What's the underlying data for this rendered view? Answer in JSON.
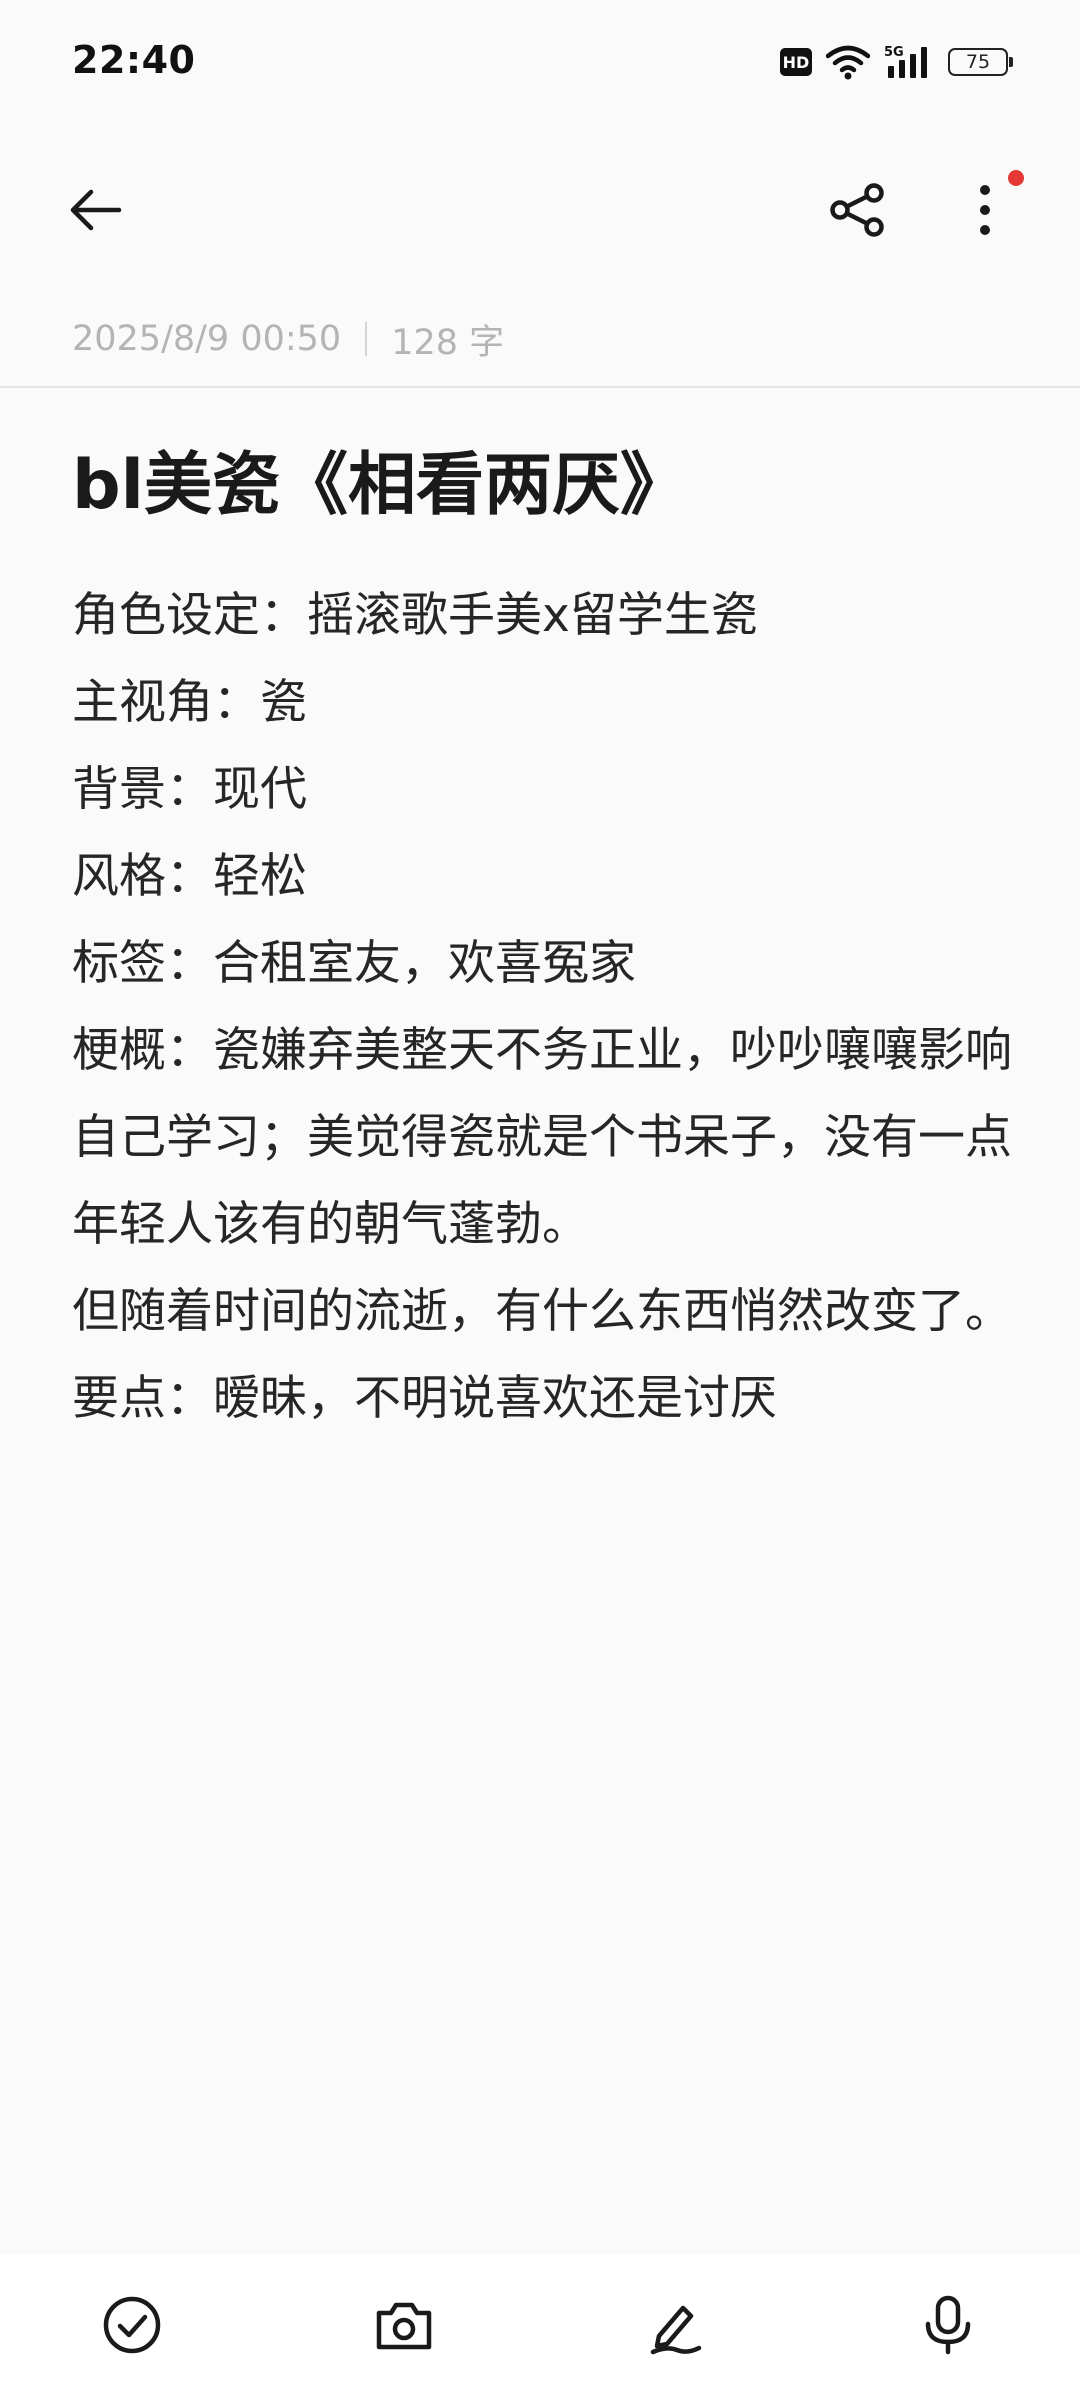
{
  "status_bar": {
    "time": "22:40",
    "hd_label": "HD",
    "network_label": "5G",
    "battery_level": "75"
  },
  "toolbar": {
    "back_icon": "arrow-left-icon",
    "share_icon": "share-icon",
    "more_icon": "more-vertical-icon",
    "notification_dot_color": "#e53935"
  },
  "note": {
    "datetime": "2025/8/9 00:50",
    "word_count": "128 字",
    "title": "bl美瓷《相看两厌》",
    "lines": [
      "角色设定：摇滚歌手美x留学生瓷",
      "主视角：瓷",
      "背景：现代",
      "风格：轻松",
      "标签：合租室友，欢喜冤家",
      "梗概：瓷嫌弃美整天不务正业，吵吵嚷嚷影响自己学习；美觉得瓷就是个书呆子，没有一点年轻人该有的朝气蓬勃。",
      "但随着时间的流逝，有什么东西悄然改变了。",
      "要点：暧昧，不明说喜欢还是讨厌"
    ]
  },
  "bottom_bar": {
    "checklist_icon": "check-circle-icon",
    "camera_icon": "camera-icon",
    "handwriting_icon": "pen-icon",
    "voice_icon": "microphone-icon"
  }
}
